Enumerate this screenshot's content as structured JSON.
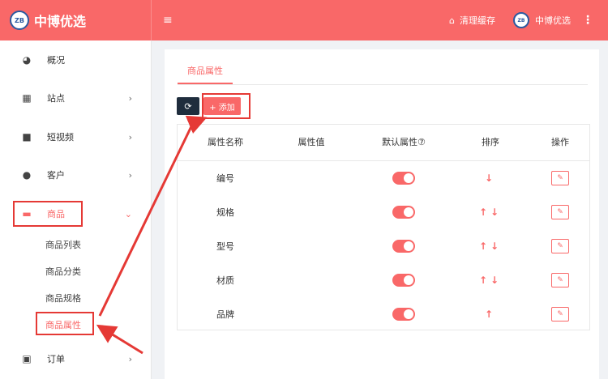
{
  "header": {
    "brand_name": "中博优选",
    "logo_text": "ZB",
    "menu_icon": "≡",
    "clear_cache_label": "清理缓存",
    "user_name": "中博优选",
    "more_icon": "⋮"
  },
  "sidebar": {
    "items": [
      {
        "label": "概况",
        "icon": "dashboard-icon",
        "glyph": "◕"
      },
      {
        "label": "站点",
        "icon": "grid-icon",
        "glyph": "▦",
        "chevron": "›"
      },
      {
        "label": "短视频",
        "icon": "video-camera-icon",
        "glyph": "■",
        "chevron": "›"
      },
      {
        "label": "客户",
        "icon": "users-icon",
        "glyph": "●",
        "chevron": "›"
      },
      {
        "label": "商品",
        "icon": "shopping-cart-icon",
        "glyph": "▬",
        "chevron": "⌄"
      },
      {
        "label": "订单",
        "icon": "money-icon",
        "glyph": "▣",
        "chevron": "›"
      }
    ],
    "sub_items": [
      "商品列表",
      "商品分类",
      "商品规格",
      "商品属性"
    ]
  },
  "main": {
    "tab_label": "商品属性",
    "refresh_icon": "⟳",
    "add_label": "+ 添加",
    "columns": [
      "属性名称",
      "属性值",
      "默认属性⑦",
      "排序",
      "操作"
    ],
    "rows": [
      {
        "name": "编号",
        "value": "",
        "up": "",
        "down": "↓"
      },
      {
        "name": "规格",
        "value": "",
        "up": "↑",
        "down": "↓"
      },
      {
        "name": "型号",
        "value": "",
        "up": "↑",
        "down": "↓"
      },
      {
        "name": "材质",
        "value": "",
        "up": "↑",
        "down": "↓"
      },
      {
        "name": "品牌",
        "value": "",
        "up": "↑",
        "down": ""
      }
    ],
    "edit_icon": "✎"
  },
  "colors": {
    "accent": "#f96868",
    "dark_button": "#1f2d3d",
    "annotation_red": "#e53935"
  }
}
